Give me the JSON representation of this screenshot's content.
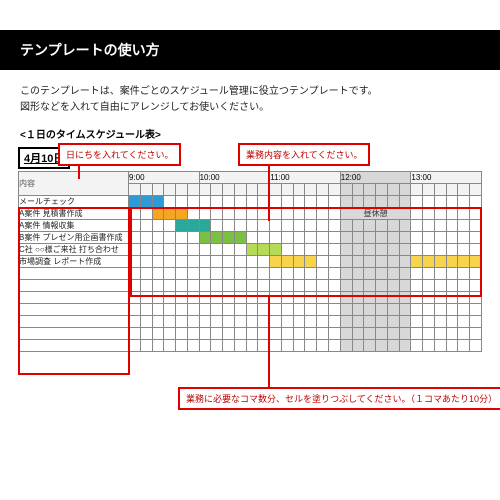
{
  "title": "テンプレートの使い方",
  "intro_line1": "このテンプレートは、案件ごとのスケジュール管理に役立つテンプレートです。",
  "intro_line2": "図形などを入れて自由にアレンジしてお使いください。",
  "section_label": "<１日のタイムスケジュール表>",
  "callouts": {
    "date": "日にちを入れてください。",
    "task": "業務内容を入れてください。",
    "cells": "業務に必要なコマ数分、セルを塗りつぶしてください。（１コマあたり10分）"
  },
  "schedule": {
    "date": "4月10日",
    "title": "タイムスケジュール表",
    "task_header": "内容",
    "hours": [
      "9:00",
      "10:00",
      "11:00",
      "12:00",
      "13:00"
    ],
    "lunch_label": "昼休憩",
    "tasks": [
      {
        "name": "メールチェック",
        "bars": [
          {
            "start": 0,
            "len": 3,
            "cls": "bar-blue"
          }
        ]
      },
      {
        "name": "A案件 見積書作成",
        "bars": [
          {
            "start": 2,
            "len": 3,
            "cls": "bar-orange"
          }
        ]
      },
      {
        "name": "A案件 情報収集",
        "bars": [
          {
            "start": 4,
            "len": 3,
            "cls": "bar-teal"
          }
        ]
      },
      {
        "name": "B案件 プレゼン用企画書作成",
        "bars": [
          {
            "start": 6,
            "len": 4,
            "cls": "bar-green"
          }
        ]
      },
      {
        "name": "C社 ○○様ご来社 打ち合わせ",
        "bars": [
          {
            "start": 10,
            "len": 3,
            "cls": "bar-lime"
          }
        ]
      },
      {
        "name": "市場調査 レポート作成",
        "bars": [
          {
            "start": 12,
            "len": 4,
            "cls": "bar-yellow"
          },
          {
            "start": 24,
            "len": 6,
            "cls": "bar-yellow"
          }
        ]
      },
      {
        "name": "",
        "bars": []
      },
      {
        "name": "",
        "bars": []
      },
      {
        "name": "",
        "bars": []
      },
      {
        "name": "",
        "bars": []
      },
      {
        "name": "",
        "bars": []
      },
      {
        "name": "",
        "bars": []
      },
      {
        "name": "",
        "bars": []
      }
    ],
    "cols_per_hour": 6,
    "lunch_hour_index": 3
  }
}
